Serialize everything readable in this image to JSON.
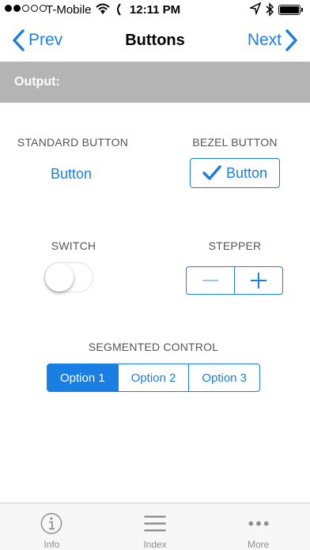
{
  "status_bar": {
    "carrier": "T-Mobile",
    "time": "12:11 PM",
    "signal_bars_filled": 2,
    "signal_bars_total": 5
  },
  "nav": {
    "back_label": "Prev",
    "title": "Buttons",
    "next_label": "Next"
  },
  "output": {
    "label": "Output:"
  },
  "standard_button": {
    "caption": "STANDARD BUTTON",
    "label": "Button"
  },
  "bezel_button": {
    "caption": "BEZEL BUTTON",
    "label": "Button",
    "checked": true
  },
  "switch": {
    "caption": "SWITCH",
    "on": false
  },
  "stepper": {
    "caption": "STEPPER",
    "decrement_enabled": false
  },
  "segmented_control": {
    "caption": "SEGMENTED CONTROL",
    "options": [
      "Option 1",
      "Option 2",
      "Option 3"
    ],
    "selected_index": 0
  },
  "tabbar": {
    "items": [
      {
        "label": "Info",
        "icon": "info-icon"
      },
      {
        "label": "Index",
        "icon": "list-icon"
      },
      {
        "label": "More",
        "icon": "more-icon"
      }
    ]
  },
  "colors": {
    "accent": "#1a7fe3",
    "output_bar": "#b4b4b4"
  }
}
